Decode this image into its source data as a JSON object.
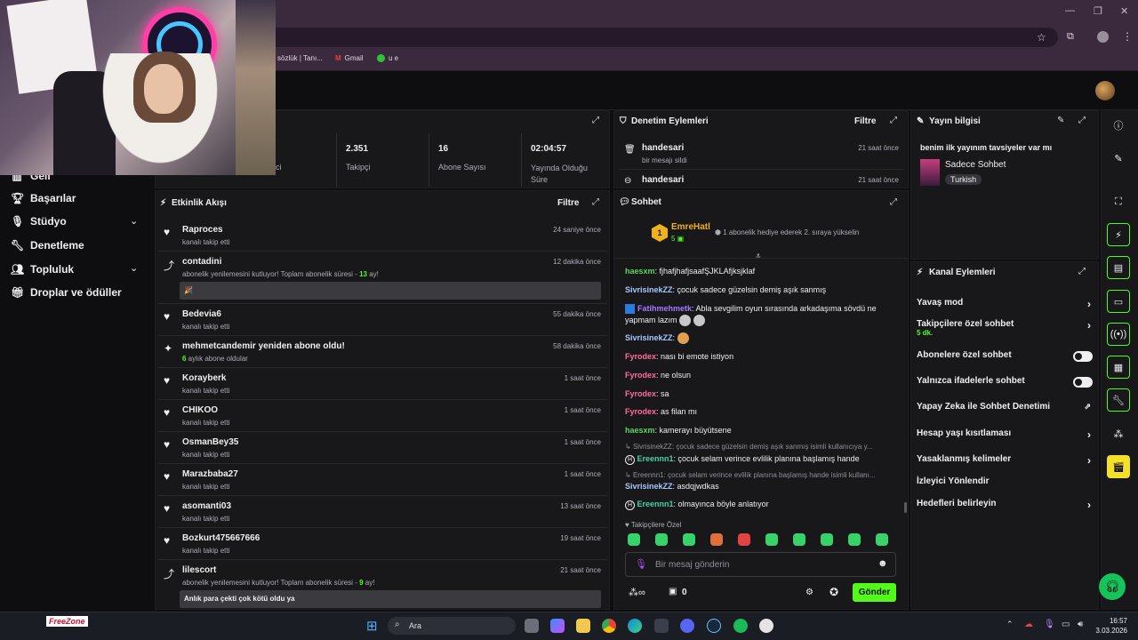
{
  "browser": {
    "bookmarks": [
      "sözlük | Tanı...",
      "Gmail",
      "u e"
    ]
  },
  "sidebar": {
    "items": [
      {
        "label": "Geli",
        "icon": "chart-icon",
        "chevron": false
      },
      {
        "label": "Başarılar",
        "icon": "trophy-icon",
        "chevron": false
      },
      {
        "label": "Stüdyo",
        "icon": "studio-icon",
        "chevron": true
      },
      {
        "label": "Denetleme",
        "icon": "wrench-icon",
        "chevron": false
      },
      {
        "label": "Topluluk",
        "icon": "community-icon",
        "chevron": true
      },
      {
        "label": "Droplar ve ödüller",
        "icon": "gift-icon",
        "chevron": false
      }
    ]
  },
  "stats": {
    "partial_label": "ci",
    "items": [
      {
        "value": "2.351",
        "label": "Takipçi"
      },
      {
        "value": "16",
        "label": "Abone Sayısı"
      },
      {
        "value": "02:04:57",
        "label": "Yayında Olduğu Süre"
      }
    ]
  },
  "activity": {
    "title": "Etkinlik Akışı",
    "filter": "Filtre",
    "items": [
      {
        "icon": "heart-icon",
        "name": "Raproces",
        "sub": "kanalı takip etti",
        "time": "24 saniye önce"
      },
      {
        "icon": "resub-icon",
        "name": "contadini",
        "sub": "abonelik yenilemesini kutluyor! Toplam abonelik süresi - ",
        "sub_hl": "13",
        "sub_end": " ay!",
        "msg": "🎉",
        "time": "12 dakika önce"
      },
      {
        "icon": "heart-icon",
        "name": "Bedevia6",
        "sub": "kanalı takip etti",
        "time": "55 dakika önce"
      },
      {
        "icon": "sparkle-icon",
        "name": "mehmetcandemir yeniden abone oldu!",
        "sub": " aylık abone oldular",
        "sub_pre": "6",
        "time": "58 dakika önce"
      },
      {
        "icon": "heart-icon",
        "name": "Korayberk",
        "sub": "kanalı takip etti",
        "time": "1 saat önce"
      },
      {
        "icon": "heart-icon",
        "name": "CHIKOO",
        "sub": "kanalı takip etti",
        "time": "1 saat önce"
      },
      {
        "icon": "heart-icon",
        "name": "OsmanBey35",
        "sub": "kanalı takip etti",
        "time": "1 saat önce"
      },
      {
        "icon": "heart-icon",
        "name": "Marazbaba27",
        "sub": "kanalı takip etti",
        "time": "1 saat önce"
      },
      {
        "icon": "heart-icon",
        "name": "asomanti03",
        "sub": "kanalı takip etti",
        "time": "13 saat önce"
      },
      {
        "icon": "heart-icon",
        "name": "Bozkurt475667666",
        "sub": "kanalı takip etti",
        "time": "19 saat önce"
      },
      {
        "icon": "resub-icon",
        "name": "lilescort",
        "sub": "abonelik yenilemesini kutluyor! Toplam abonelik süresi - ",
        "sub_hl": "9",
        "sub_end": " ay!",
        "msg": "Anlık para çekti çok kötü oldu ya",
        "time": "21 saat önce"
      }
    ]
  },
  "moderation": {
    "title": "Denetim Eylemleri",
    "filter": "Filtre",
    "items": [
      {
        "name": "handesari",
        "sub": "bir mesajı sildi",
        "time": "21 saat önce"
      },
      {
        "name": "handesari",
        "sub": "",
        "time": "21 saat önce"
      }
    ]
  },
  "chat": {
    "title": "Sohbet",
    "pinned_user": "EmreHatl",
    "pinned_rank": "1",
    "pinned_count": "5",
    "pinned_text": "1 abonelik hediye ederek 2. sıraya yükselin",
    "messages": [
      {
        "user": "haesxm",
        "color": "#5cd65c",
        "text": "fjhafjhafjsaafŞJKLAfjksjklaf",
        "emotes": 0
      },
      {
        "user": "SivrisinekZZ",
        "color": "#a9c7ff",
        "text": "çocuk sadece güzelsin demiş aşık sanmış",
        "emotes": 0
      },
      {
        "user": "Fatihmehmetk",
        "color": "#a07bff",
        "text": "Abla sevgilim oyun sırasında arkadaşıma sövdü ne yapmam lazım",
        "emotes": 2
      },
      {
        "user": "SivrisinekZZ",
        "color": "#a9c7ff",
        "text": "",
        "emotes": 1
      },
      {
        "user": "Fyrodex",
        "color": "#ff6b9a",
        "text": "nası bi emote istiyon",
        "emotes": 0
      },
      {
        "user": "Fyrodex",
        "color": "#ff6b9a",
        "text": "ne olsun",
        "emotes": 0
      },
      {
        "user": "Fyrodex",
        "color": "#ff6b9a",
        "text": "sa",
        "emotes": 0
      },
      {
        "user": "Fyrodex",
        "color": "#ff6b9a",
        "text": "as filan mı",
        "emotes": 0
      },
      {
        "user": "haesxm",
        "color": "#5cd65c",
        "text": "kamerayı büyütsene",
        "emotes": 0
      }
    ],
    "reply1": "SivrisinekZZ: çocuk sadece güzelsin demiş aşık sanmış isimli kullanıcıya y...",
    "reply1_user": "Ereennn1",
    "reply1_text": "çocuk selam verince evlilik planına başlamış hande",
    "reply2": "Ereennn1: çocuk selam verince evlilik planına başlamış hande isimli kullanı...",
    "msg_after_user": "SivrisinekZZ",
    "msg_after_text": "asdqjwdkas",
    "last_user": "Ereennn1",
    "last_text": "olmayınca böyle anlatıyor",
    "follower_only_label": "Takipçilere Özel",
    "input_placeholder": "Bir mesaj gönderin",
    "points": "0",
    "send_label": "Gönder"
  },
  "stream_info": {
    "title": "Yayın bilgisi",
    "stream_title": "benim ilk yayınım tavsiyeler var mı",
    "category": "Sadece Sohbet",
    "tag": "Turkish"
  },
  "channel_actions": {
    "title": "Kanal Eylemleri",
    "items": [
      {
        "label": "Yavaş mod",
        "control": "chevron"
      },
      {
        "label": "Takipçilere özel sohbet",
        "sub": "5 dk.",
        "control": "chevron"
      },
      {
        "label": "Abonelere özel sohbet",
        "control": "toggle"
      },
      {
        "label": "Yalnızca ifadelerle sohbet",
        "control": "toggle"
      },
      {
        "label": "Yapay Zeka ile Sohbet Denetimi",
        "control": "external"
      },
      {
        "label": "Hesap yaşı kısıtlaması",
        "control": "chevron"
      },
      {
        "label": "Yasaklanmış kelimeler",
        "control": "chevron"
      },
      {
        "label": "İzleyici Yönlendir",
        "control": "none"
      },
      {
        "label": "Hedefleri belirleyin",
        "control": "chevron"
      }
    ]
  },
  "taskbar": {
    "search_label": "Ara",
    "time": "16:57",
    "date": "3.03.2026",
    "widget_label": "FreeZone"
  },
  "colors": {
    "accent_green": "#53fc18",
    "panel": "#18181b",
    "bg": "#0e0e10"
  }
}
